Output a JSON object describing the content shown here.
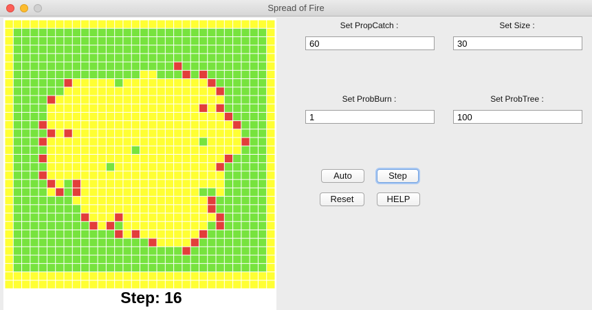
{
  "window": {
    "title": "Spread of Fire"
  },
  "grid": {
    "rows": 32,
    "cols": 32,
    "colors": {
      "border": "#ffff33",
      "tree": "#77e33e",
      "burning": "#e23e3a",
      "empty": "#ffff33",
      "gridline": "#ffffff"
    },
    "map": [
      "EEEEEEEEEEEEEEEEEEEEEEEEEEEEEEEE",
      "ETTTTTTTTTTTTTTTTTTTTTTTTTTTTTTE",
      "ETTTTTTTTTTTTTTTTTTTTTTTTTTTTTTE",
      "ETTTTTTTTTTTTTTTTTTTTTTTTTTTTTTE",
      "ETTTTTTTTTTTTTTTTTTTTTTTTTTTTTTE",
      "ETTTTTTTTTTTTTTTTTTTBTTTTTTTTTTE",
      "ETTTTTTTTTTTTTTTEETTTBTBTTTTTTTE",
      "ETTTTTTBEEEEETEEEEEEEEEEBTTTTTTE",
      "ETTTTTTEEEEEEEEEEEEEEEEEEBTTTTTE",
      "ETTTTBEEEEEEEEEEEEEEEEEEEETTTTTE",
      "ETTTTEEEEEEEEEEEEEEEEEEBEBTTTTTE",
      "ETTTTEEEEEEEEEEEEEEEEEEEEEBTTTTE",
      "ETTTBEEEEEEEEEEEEEEEEEEEEEEBTTTE",
      "ETTTTBEBEEEEEEEEEEEEEEEEEEEETTTE",
      "ETTTBEEEEEEEEEEEEEEEEEETEEEEBTTE",
      "ETTTTEEEEEEEEEETEEEEEEEEEEEETTTE",
      "ETTTBEEEEEEEEEEEEEEEEEEEEEBTTTTE",
      "ETTTTEEEEEEETEEEEEEEEEEEEBTTTTTE",
      "ETTTBEEEEEEEEEEEEEEEEEEEEETTTTTE",
      "ETTTTBETBEEEEEEEEEEEEEEEEETTTTTE",
      "ETTTTEBTBEEEEEEEEEEEEEETTETTTTTE",
      "ETTTTTTTEEEEEEEEEEEEEEEEBTTTTTTE",
      "ETTTTTTTTEEEEEEEEEEEEEEEBTTTTTTE",
      "ETTTTTTTTBEEEBEEEEEEEEEEEBTTTTTE",
      "ETTTTTTTTTBEBTEEEEEEEEEETBTTTTTE",
      "ETTTTTTTTTTTTBEBEEEEEEEBTTTTTTTE",
      "ETTTTTTTTTTTTTTTTBEEEEBTTTTTTTTE",
      "ETTTTTTTTTTTTTTTTTTTTBTTTTTTTTTE",
      "ETTTTTTTTTTTTTTTTTTTTTTTTTTTTTTE",
      "ETTTTTTTTTTTTTTTTTTTTTTTTTTTTTTE",
      "EEEEEEEEEEEEEEEEEEEEEEEEEEEEEEEE",
      "EEEEEEEEEEEEEEEEEEEEEEEEEEEEEEEE"
    ]
  },
  "status": {
    "step_text": "Step: 16"
  },
  "controls": {
    "prop_catch": {
      "label": "Set PropCatch :",
      "value": "60"
    },
    "size": {
      "label": "Set Size :",
      "value": "30"
    },
    "prob_burn": {
      "label": "Set ProbBurn :",
      "value": "1"
    },
    "prob_tree": {
      "label": "Set ProbTree :",
      "value": "100"
    }
  },
  "buttons": {
    "auto": "Auto",
    "step": "Step",
    "reset": "Reset",
    "help": "HELP"
  }
}
